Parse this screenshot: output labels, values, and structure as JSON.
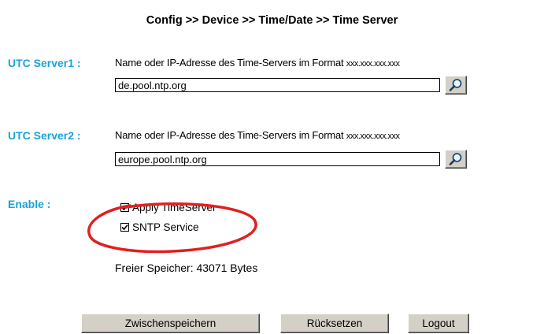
{
  "breadcrumb": "Config >> Device >> Time/Date >> Time Server",
  "server1": {
    "label": "UTC Server1 :",
    "description": "Name oder IP-Adresse des Time-Servers im Format ",
    "format": "xxx.xxx.xxx.xxx",
    "value": "de.pool.ntp.org"
  },
  "server2": {
    "label": "UTC Server2 :",
    "description": "Name oder IP-Adresse des Time-Servers im Format ",
    "format": "xxx.xxx.xxx.xxx",
    "value": "europe.pool.ntp.org"
  },
  "enable": {
    "label": "Enable :",
    "options": [
      {
        "label": "Apply TimeServer",
        "checked": true
      },
      {
        "label": "SNTP Service",
        "checked": true
      }
    ]
  },
  "memory": "Freier Speicher: 43071 Bytes",
  "buttons": {
    "save": "Zwischenspeichern",
    "reset": "Rücksetzen",
    "logout": "Logout"
  },
  "colors": {
    "label": "#1aa3d9",
    "highlight_ellipse": "#e02020"
  }
}
